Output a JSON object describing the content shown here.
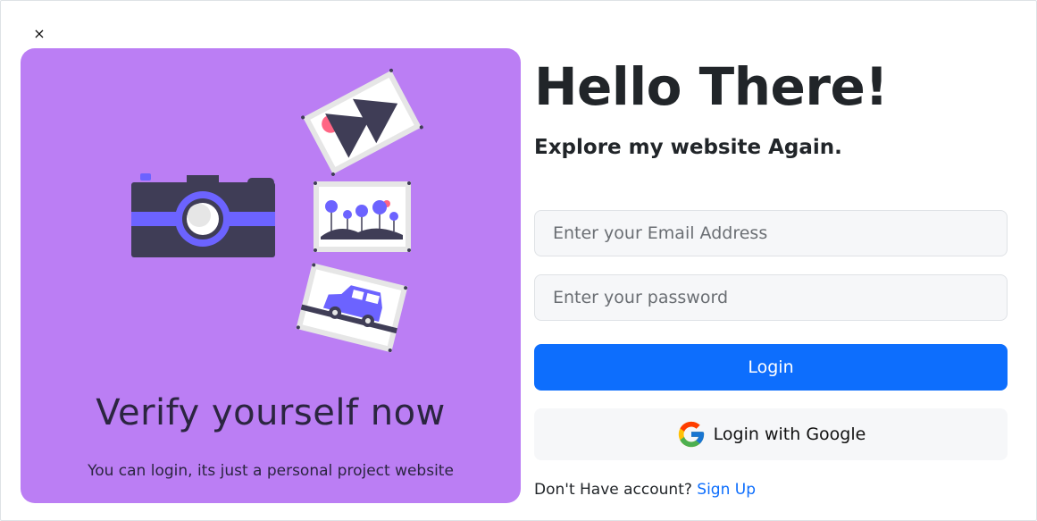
{
  "dialog": {
    "close_label": "×"
  },
  "left": {
    "title": "Verify yourself now",
    "subtitle": "You can login, its just a personal project website",
    "background_color": "#bb7ef4"
  },
  "form": {
    "heading": "Hello There!",
    "subheading": "Explore my website Again.",
    "email_placeholder": "Enter your Email Address",
    "password_placeholder": "Enter your password",
    "login_label": "Login",
    "google_label": "Login with Google",
    "signup_prompt": "Don't Have account?",
    "signup_link": "Sign Up",
    "accent_color": "#0d6efd"
  }
}
